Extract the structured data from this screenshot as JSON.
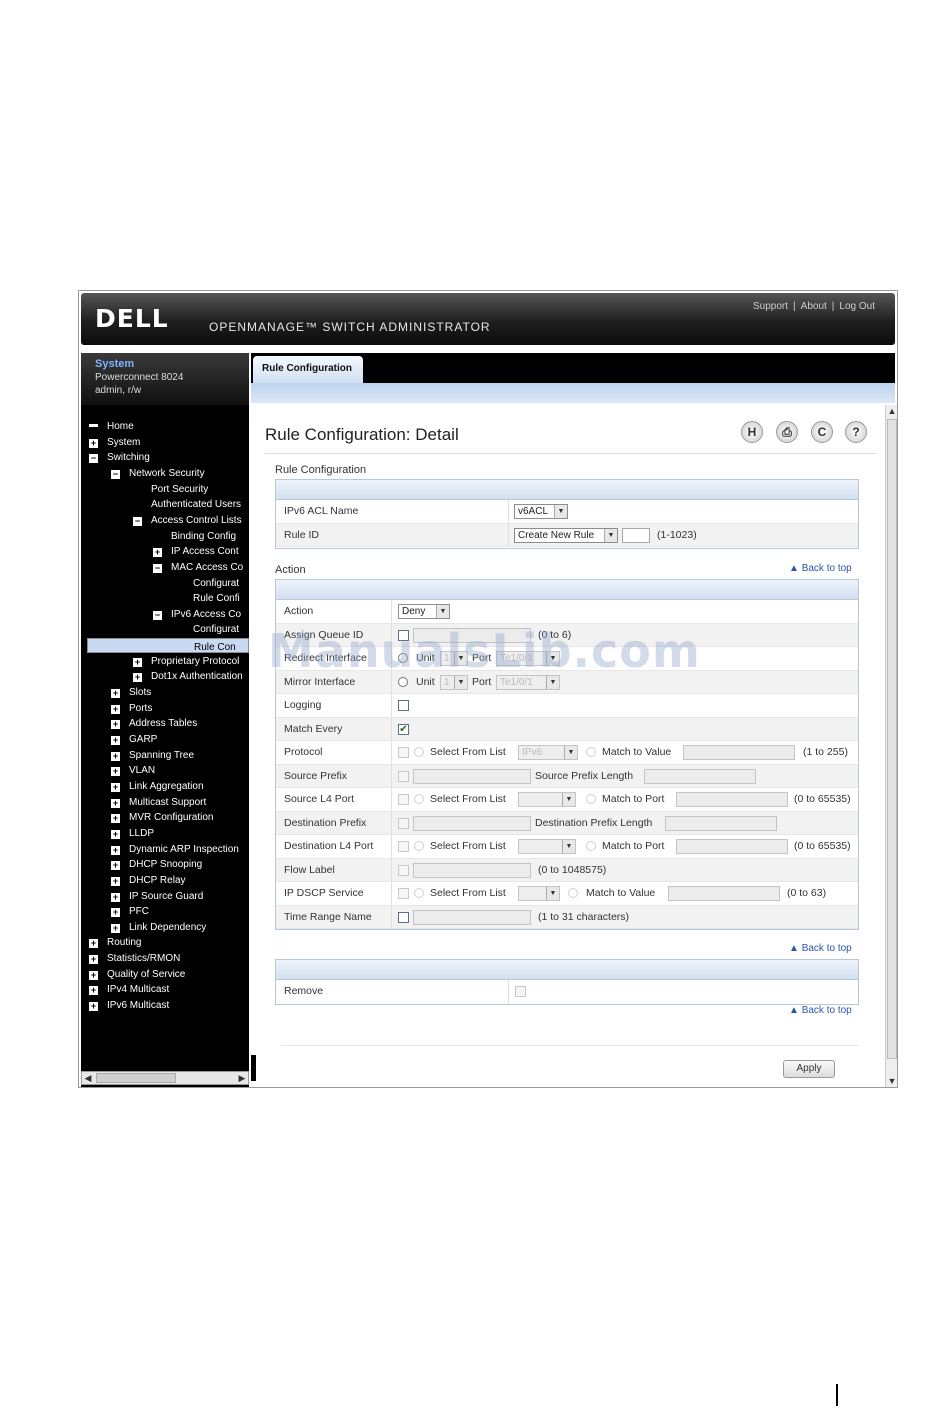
{
  "header": {
    "logo": "DELL",
    "app_title": "OPENMANAGE™ SWITCH ADMINISTRATOR",
    "links": [
      "Support",
      "About",
      "Log Out"
    ]
  },
  "system_box": {
    "title": "System",
    "device": "Powerconnect 8024",
    "user": "admin, r/w"
  },
  "nav_tree": [
    {
      "label": "Home",
      "toggle": "home",
      "level": 0
    },
    {
      "label": "System",
      "toggle": "+",
      "level": 0
    },
    {
      "label": "Switching",
      "toggle": "-",
      "level": 0
    },
    {
      "label": "Network Security",
      "toggle": "-",
      "level": 1
    },
    {
      "label": "Port Security",
      "toggle": "",
      "level": 2
    },
    {
      "label": "Authenticated Users",
      "toggle": "",
      "level": 2
    },
    {
      "label": "Access Control Lists",
      "toggle": "-",
      "level": 2
    },
    {
      "label": "Binding Config",
      "toggle": "",
      "level": 3
    },
    {
      "label": "IP Access Cont",
      "toggle": "+",
      "level": 3
    },
    {
      "label": "MAC Access Co",
      "toggle": "-",
      "level": 3
    },
    {
      "label": "Configurat",
      "toggle": "",
      "level": 4
    },
    {
      "label": "Rule Confi",
      "toggle": "",
      "level": 4
    },
    {
      "label": "IPv6 Access Co",
      "toggle": "-",
      "level": 3
    },
    {
      "label": "Configurat",
      "toggle": "",
      "level": 4
    },
    {
      "label": "Rule Con",
      "toggle": "",
      "level": 4,
      "selected": true
    },
    {
      "label": "Proprietary Protocol",
      "toggle": "+",
      "level": 2
    },
    {
      "label": "Dot1x Authentication",
      "toggle": "+",
      "level": 2
    },
    {
      "label": "Slots",
      "toggle": "+",
      "level": 1
    },
    {
      "label": "Ports",
      "toggle": "+",
      "level": 1
    },
    {
      "label": "Address Tables",
      "toggle": "+",
      "level": 1
    },
    {
      "label": "GARP",
      "toggle": "+",
      "level": 1
    },
    {
      "label": "Spanning Tree",
      "toggle": "+",
      "level": 1
    },
    {
      "label": "VLAN",
      "toggle": "+",
      "level": 1
    },
    {
      "label": "Link Aggregation",
      "toggle": "+",
      "level": 1
    },
    {
      "label": "Multicast Support",
      "toggle": "+",
      "level": 1
    },
    {
      "label": "MVR Configuration",
      "toggle": "+",
      "level": 1
    },
    {
      "label": "LLDP",
      "toggle": "+",
      "level": 1
    },
    {
      "label": "Dynamic ARP Inspection",
      "toggle": "+",
      "level": 1
    },
    {
      "label": "DHCP Snooping",
      "toggle": "+",
      "level": 1
    },
    {
      "label": "DHCP Relay",
      "toggle": "+",
      "level": 1
    },
    {
      "label": "IP Source Guard",
      "toggle": "+",
      "level": 1
    },
    {
      "label": "PFC",
      "toggle": "+",
      "level": 1
    },
    {
      "label": "Link Dependency",
      "toggle": "+",
      "level": 1
    },
    {
      "label": "Routing",
      "toggle": "+",
      "level": 0
    },
    {
      "label": "Statistics/RMON",
      "toggle": "+",
      "level": 0
    },
    {
      "label": "Quality of Service",
      "toggle": "+",
      "level": 0
    },
    {
      "label": "IPv4 Multicast",
      "toggle": "+",
      "level": 0
    },
    {
      "label": "IPv6 Multicast",
      "toggle": "+",
      "level": 0
    }
  ],
  "tab": {
    "label": "Rule Configuration"
  },
  "page": {
    "title": "Rule Configuration: Detail",
    "toolbar_icons": [
      "save-icon",
      "print-icon",
      "refresh-icon",
      "help-icon"
    ],
    "toolbar_glyphs": [
      "H",
      "⎙",
      "C",
      "?"
    ],
    "section_rule": "Rule Configuration",
    "section_action": "Action",
    "back_to_top": "Back to top"
  },
  "rule_config": {
    "acl_name_label": "IPv6 ACL Name",
    "acl_name_value": "v6ACL",
    "rule_id_label": "Rule ID",
    "rule_id_value": "Create New Rule",
    "rule_id_range": "(1-1023)"
  },
  "action_rows": {
    "action": {
      "label": "Action",
      "value": "Deny"
    },
    "queue": {
      "label": "Assign Queue ID",
      "range": "(0 to 6)"
    },
    "redirect": {
      "label": "Redirect Interface",
      "unit_label": "Unit",
      "unit_value": "1",
      "port_label": "Port",
      "port_value": "Te1/0/1"
    },
    "mirror": {
      "label": "Mirror Interface",
      "unit_label": "Unit",
      "unit_value": "1",
      "port_label": "Port",
      "port_value": "Te1/0/1"
    },
    "logging": {
      "label": "Logging"
    },
    "match_every": {
      "label": "Match Every",
      "checked": true
    },
    "protocol": {
      "label": "Protocol",
      "select_label": "Select From List",
      "select_value": "IPv6",
      "match_label": "Match to Value",
      "range": "(1 to 255)"
    },
    "src_prefix": {
      "label": "Source Prefix",
      "len_label": "Source Prefix Length"
    },
    "src_l4": {
      "label": "Source L4 Port",
      "select_label": "Select From List",
      "match_label": "Match to Port",
      "range": "(0 to 65535)"
    },
    "dst_prefix": {
      "label": "Destination Prefix",
      "len_label": "Destination Prefix Length"
    },
    "dst_l4": {
      "label": "Destination L4 Port",
      "select_label": "Select From List",
      "match_label": "Match to Port",
      "range": "(0 to 65535)"
    },
    "flow": {
      "label": "Flow Label",
      "range": "(0 to 1048575)"
    },
    "dscp": {
      "label": "IP DSCP Service",
      "select_label": "Select From List",
      "match_label": "Match to Value",
      "range": "(0 to 63)"
    },
    "time_range": {
      "label": "Time Range Name",
      "range": "(1 to 31 characters)"
    }
  },
  "remove_row": {
    "label": "Remove"
  },
  "apply_label": "Apply",
  "watermark": "ManualsLib.com",
  "colors": {
    "banner": "#1e1e1e",
    "tab": "#cfdff2",
    "panel_header": "#d3e1f1",
    "link": "#2a56a8",
    "selected_nav": "#c8d9f2"
  }
}
